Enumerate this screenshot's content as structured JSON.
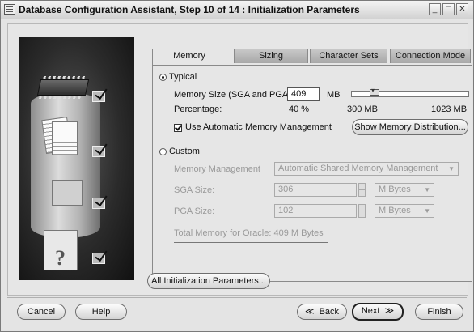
{
  "window": {
    "title": "Database Configuration Assistant, Step 10 of 14 : Initialization Parameters",
    "controls": {
      "minimize": "_",
      "maximize": "□",
      "close": "✕"
    }
  },
  "tabs": [
    {
      "label": "Memory",
      "active": true
    },
    {
      "label": "Sizing",
      "active": false
    },
    {
      "label": "Character Sets",
      "active": false
    },
    {
      "label": "Connection Mode",
      "active": false
    }
  ],
  "memory": {
    "typical": {
      "label": "Typical",
      "selected": true,
      "memory_size_label": "Memory Size (SGA and PGA):",
      "memory_size_value": "409",
      "memory_size_unit": "MB",
      "percentage_label": "Percentage:",
      "percentage_value": "40 %",
      "slider_min": "300 MB",
      "slider_max": "1023 MB",
      "auto_memory_label": "Use Automatic Memory Management",
      "auto_memory_checked": true,
      "show_distribution_button": "Show Memory Distribution..."
    },
    "custom": {
      "label": "Custom",
      "selected": false,
      "memory_management_label": "Memory Management",
      "memory_management_value": "Automatic Shared Memory Management",
      "sga_label": "SGA Size:",
      "sga_value": "306",
      "sga_unit": "M Bytes",
      "pga_label": "PGA Size:",
      "pga_value": "102",
      "pga_unit": "M Bytes",
      "total_memory_text": "Total Memory for Oracle:  409 M Bytes"
    }
  },
  "all_params_button": "All Initialization Parameters...",
  "footer": {
    "cancel": "Cancel",
    "help": "Help",
    "back": "Back",
    "back_glyph": "≪",
    "next": "Next",
    "next_glyph": "≫",
    "finish": "Finish"
  }
}
